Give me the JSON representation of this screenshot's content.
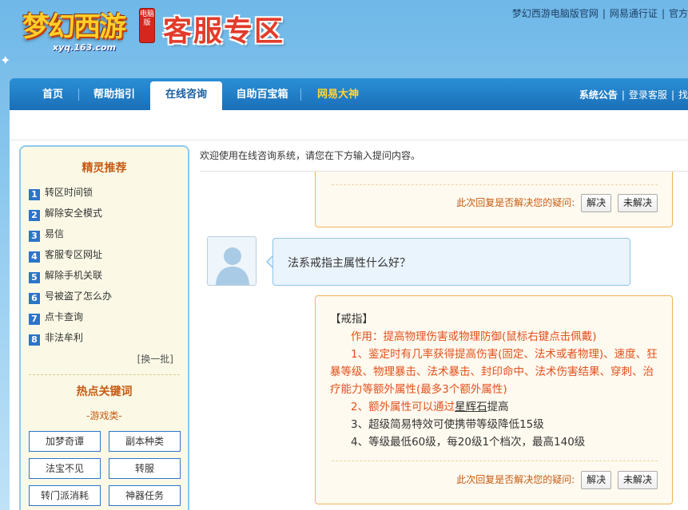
{
  "header": {
    "logo_text": "梦幻西游",
    "logo_badge": "电脑版",
    "logo_url": "xyq.163.com",
    "title": "客服专区",
    "top_links": [
      "梦幻西游电脑版官网",
      "网易通行证",
      "官方"
    ]
  },
  "nav": {
    "items": [
      {
        "label": "首页"
      },
      {
        "label": "帮助指引"
      },
      {
        "label": "在线咨询"
      },
      {
        "label": "自助百宝箱"
      },
      {
        "label": "网易大神"
      }
    ],
    "right": [
      "系统公告",
      "登录客服",
      "找"
    ]
  },
  "sidebar": {
    "recommend_title": "精灵推荐",
    "recommend": [
      {
        "num": "1",
        "label": "转区时间锁"
      },
      {
        "num": "2",
        "label": "解除安全模式"
      },
      {
        "num": "3",
        "label": "易信"
      },
      {
        "num": "4",
        "label": "客服专区网址"
      },
      {
        "num": "5",
        "label": "解除手机关联"
      },
      {
        "num": "6",
        "label": "号被盗了怎么办"
      },
      {
        "num": "7",
        "label": "点卡查询"
      },
      {
        "num": "8",
        "label": "非法牟利"
      }
    ],
    "swap_label": "[换一批]",
    "hot_title": "热点关键词",
    "hot_sub": "-游戏类-",
    "keywords": [
      "加梦奇谭",
      "副本种类",
      "法宝不见",
      "转服",
      "转门派消耗",
      "神器任务"
    ]
  },
  "chat": {
    "welcome": "欢迎使用在线咨询系统，请您在下方输入提问内容。",
    "feedback_prompt": "此次回复是否解决您的疑问:",
    "resolved_label": "解决",
    "unresolved_label": "未解决",
    "question": "法系戒指主属性什么好？",
    "answer": {
      "heading": "【戒指】",
      "line1": "作用：提高物理伤害或物理防御(鼠标右键点击佩戴)",
      "line2": "1、鉴定时有几率获得提高伤害(固定、法术或者物理)、速度、狂暴等级、物理暴击、法术暴击、封印命中、法术伤害结果、穿刺、治疗能力等额外属性(最多3个额外属性)",
      "line3_pre": "2、额外属性可以通过",
      "line3_link": "星辉石",
      "line3_post": "提高",
      "line4": "3、超级简易特效可使携带等级降低15级",
      "line5": "4、等级最低60级，每20级1个档次，最高140级"
    }
  }
}
